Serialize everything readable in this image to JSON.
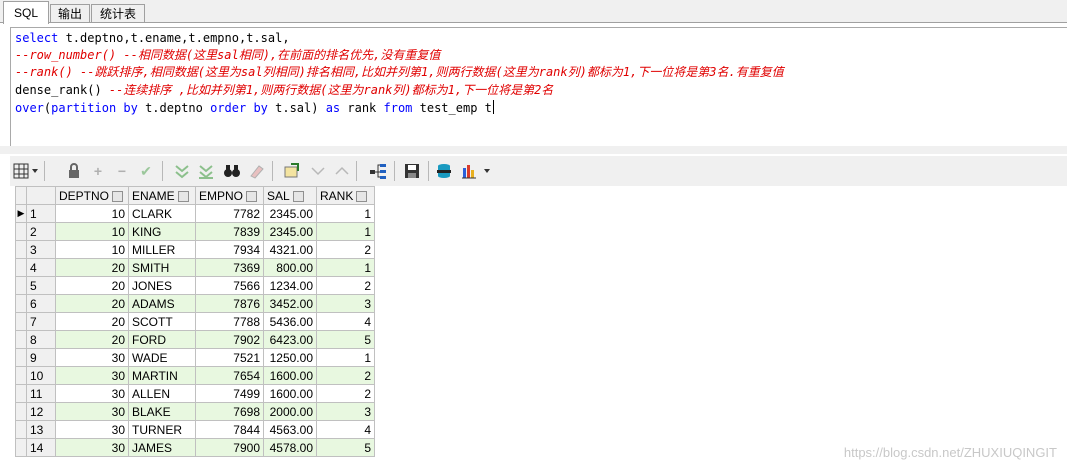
{
  "tabs": [
    "SQL",
    "输出",
    "统计表"
  ],
  "editor": {
    "lines": [
      {
        "kw": "select",
        "rest": " t.deptno,t.ename,t.empno,t.sal,"
      },
      {
        "comment": "--row_number() --相同数据(这里sal相同),在前面的排名优先,没有重复值"
      },
      {
        "comment": "--rank() --跳跃排序,相同数据(这里为sal列相同)排名相同,比如并列第1,则两行数据(这里为rank列)都标为1,下一位将是第3名.有重复值"
      },
      {
        "code": "dense_rank() ",
        "comment": "--连续排序 ,比如并列第1,则两行数据(这里为rank列)都标为1,下一位将是第2名"
      },
      {
        "kw": "over",
        "a": "(",
        "kw2": "partition by",
        "b": " t.deptno ",
        "kw3": "order by",
        "c": " t.sal) ",
        "kw4": "as",
        "d": " rank ",
        "kw5": "from",
        "e": " test_emp t"
      }
    ]
  },
  "toolbar": {
    "icons": [
      "grid-icon",
      "lock-icon",
      "add-icon",
      "remove-icon",
      "check-icon",
      "filter-down-icon",
      "filter-clear-icon",
      "binoculars-icon",
      "eraser-icon",
      "export-icon",
      "prev-icon",
      "next-icon",
      "tree-icon",
      "save-icon",
      "db-icon",
      "chart-icon"
    ]
  },
  "grid": {
    "columns": [
      "DEPTNO",
      "ENAME",
      "EMPNO",
      "SAL",
      "RANK"
    ],
    "rows": [
      [
        "1",
        "10",
        "CLARK",
        "7782",
        "2345.00",
        "1"
      ],
      [
        "2",
        "10",
        "KING",
        "7839",
        "2345.00",
        "1"
      ],
      [
        "3",
        "10",
        "MILLER",
        "7934",
        "4321.00",
        "2"
      ],
      [
        "4",
        "20",
        "SMITH",
        "7369",
        "800.00",
        "1"
      ],
      [
        "5",
        "20",
        "JONES",
        "7566",
        "1234.00",
        "2"
      ],
      [
        "6",
        "20",
        "ADAMS",
        "7876",
        "3452.00",
        "3"
      ],
      [
        "7",
        "20",
        "SCOTT",
        "7788",
        "5436.00",
        "4"
      ],
      [
        "8",
        "20",
        "FORD",
        "7902",
        "6423.00",
        "5"
      ],
      [
        "9",
        "30",
        "WADE",
        "7521",
        "1250.00",
        "1"
      ],
      [
        "10",
        "30",
        "MARTIN",
        "7654",
        "1600.00",
        "2"
      ],
      [
        "11",
        "30",
        "ALLEN",
        "7499",
        "1600.00",
        "2"
      ],
      [
        "12",
        "30",
        "BLAKE",
        "7698",
        "2000.00",
        "3"
      ],
      [
        "13",
        "30",
        "TURNER",
        "7844",
        "4563.00",
        "4"
      ],
      [
        "14",
        "30",
        "JAMES",
        "7900",
        "4578.00",
        "5"
      ]
    ]
  },
  "watermark": "https://blog.csdn.net/ZHUXIUQINGIT",
  "colors": {
    "keyword": "#0000ff",
    "comment": "#e00000",
    "alt_row": "#e8f8e0"
  }
}
